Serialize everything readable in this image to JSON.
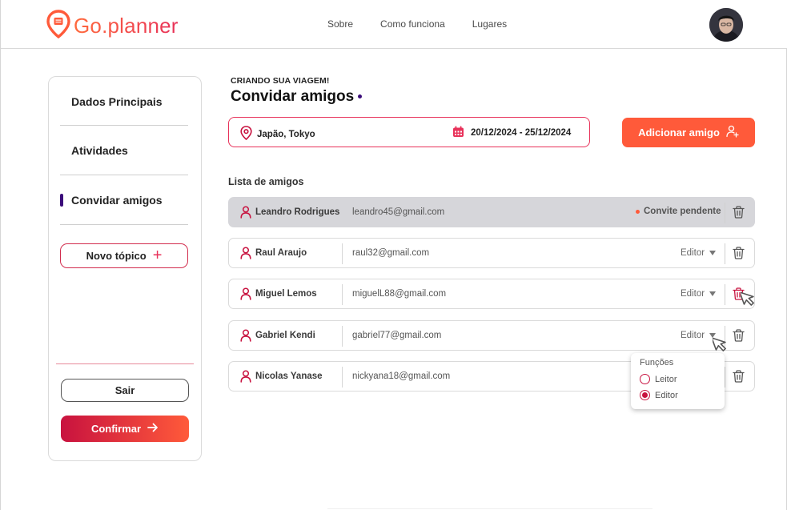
{
  "brand": {
    "name_prefix": "Go",
    "name_suffix": ".planner",
    "accent": "#e8325a",
    "accent2": "#ff5a3a",
    "purple": "#3b0c7a"
  },
  "nav": {
    "items": [
      "Sobre",
      "Como funciona",
      "Lugares"
    ]
  },
  "sidebar": {
    "items": [
      "Dados Principais",
      "Atividades",
      "Convidar amigos"
    ],
    "active": "Convidar amigos",
    "new_topic_label": "Novo tópico",
    "logout_label": "Sair",
    "confirm_label": "Confirmar"
  },
  "main": {
    "eyebrow": "CRIANDO SUA VIAGEM!",
    "title": "Convidar amigos",
    "trip": {
      "location": "Japão, Tokyo",
      "dates": "20/12/2024 - 25/12/2024"
    },
    "add_friend_label": "Adicionar amigo",
    "list_label": "Lista de amigos",
    "friends": [
      {
        "name": "Leandro Rodrigues",
        "email": "leandro45@gmail.com",
        "status": "Convite pendente"
      },
      {
        "name": "Raul Araujo",
        "email": "raul32@gmail.com",
        "role": "Editor"
      },
      {
        "name": "Miguel Lemos",
        "email": "miguelL88@gmail.com",
        "role": "Editor"
      },
      {
        "name": "Gabriel Kendi",
        "email": "gabriel77@gmail.com",
        "role": "Editor"
      },
      {
        "name": "Nicolas Yanase",
        "email": "nickyana18@gmail.com",
        "role": ""
      }
    ],
    "roles_menu": {
      "title": "Funções",
      "options": [
        "Leitor",
        "Editor"
      ],
      "selected": "Editor"
    }
  },
  "icons": [
    "map-pin-logo-icon",
    "map-pin-icon",
    "calendar-icon",
    "user-add-icon",
    "user-icon",
    "trash-icon",
    "arrow-right-icon",
    "cursor-icon"
  ]
}
